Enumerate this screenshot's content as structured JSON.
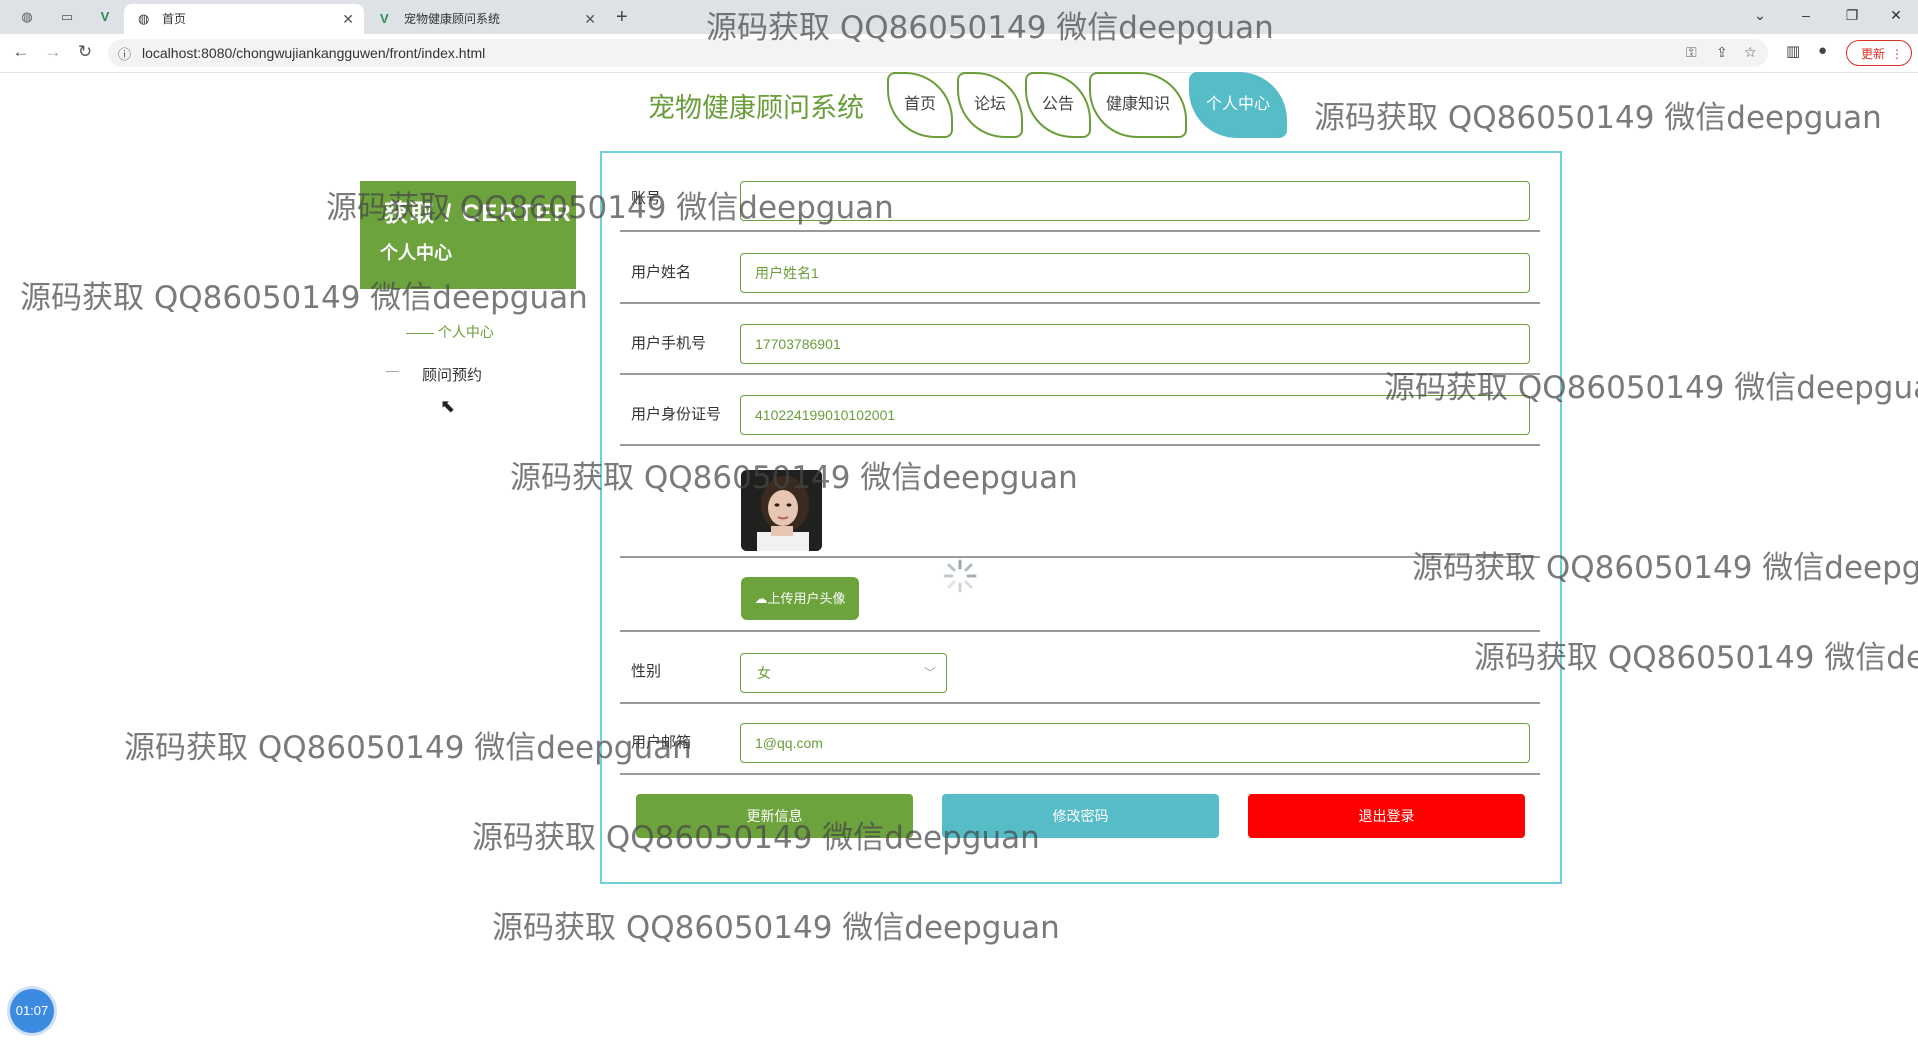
{
  "browser": {
    "tabs": [
      {
        "label": "首页",
        "active": true
      },
      {
        "label": "宠物健康顾问系统",
        "active": false
      }
    ],
    "new_tab": "+",
    "url": "localhost:8080/chongwujiankangguwen/front/index.html",
    "update_label": "更新"
  },
  "site": {
    "title": "宠物健康顾问系统",
    "nav": [
      "首页",
      "论坛",
      "公告",
      "健康知识",
      "个人中心"
    ],
    "active_nav": "个人中心"
  },
  "sidebar": {
    "header_title": "获取 / CERTER",
    "header_subtitle": "个人中心",
    "items": [
      {
        "label": "—— 个人中心",
        "active": true
      },
      {
        "label": "顾问预约",
        "active": false
      }
    ]
  },
  "form": {
    "fields": [
      {
        "label": "账号",
        "value": ""
      },
      {
        "label": "用户姓名",
        "value": "用户姓名1"
      },
      {
        "label": "用户手机号",
        "value": "17703786901"
      },
      {
        "label": "用户身份证号",
        "value": "410224199010102001"
      }
    ],
    "upload_label": "上传用户头像",
    "gender_label": "性别",
    "gender_value": "女",
    "email_label": "用户邮箱",
    "email_value": "1@qq.com",
    "buttons": {
      "update": "更新信息",
      "change_password": "修改密码",
      "logout": "退出登录"
    }
  },
  "colors": {
    "primary_green": "#6da33d",
    "accent_cyan": "#55bcc8",
    "danger_red": "#ff0000"
  },
  "clock": "01:07",
  "watermark": "源码获取 QQ86050149 微信deepguan"
}
